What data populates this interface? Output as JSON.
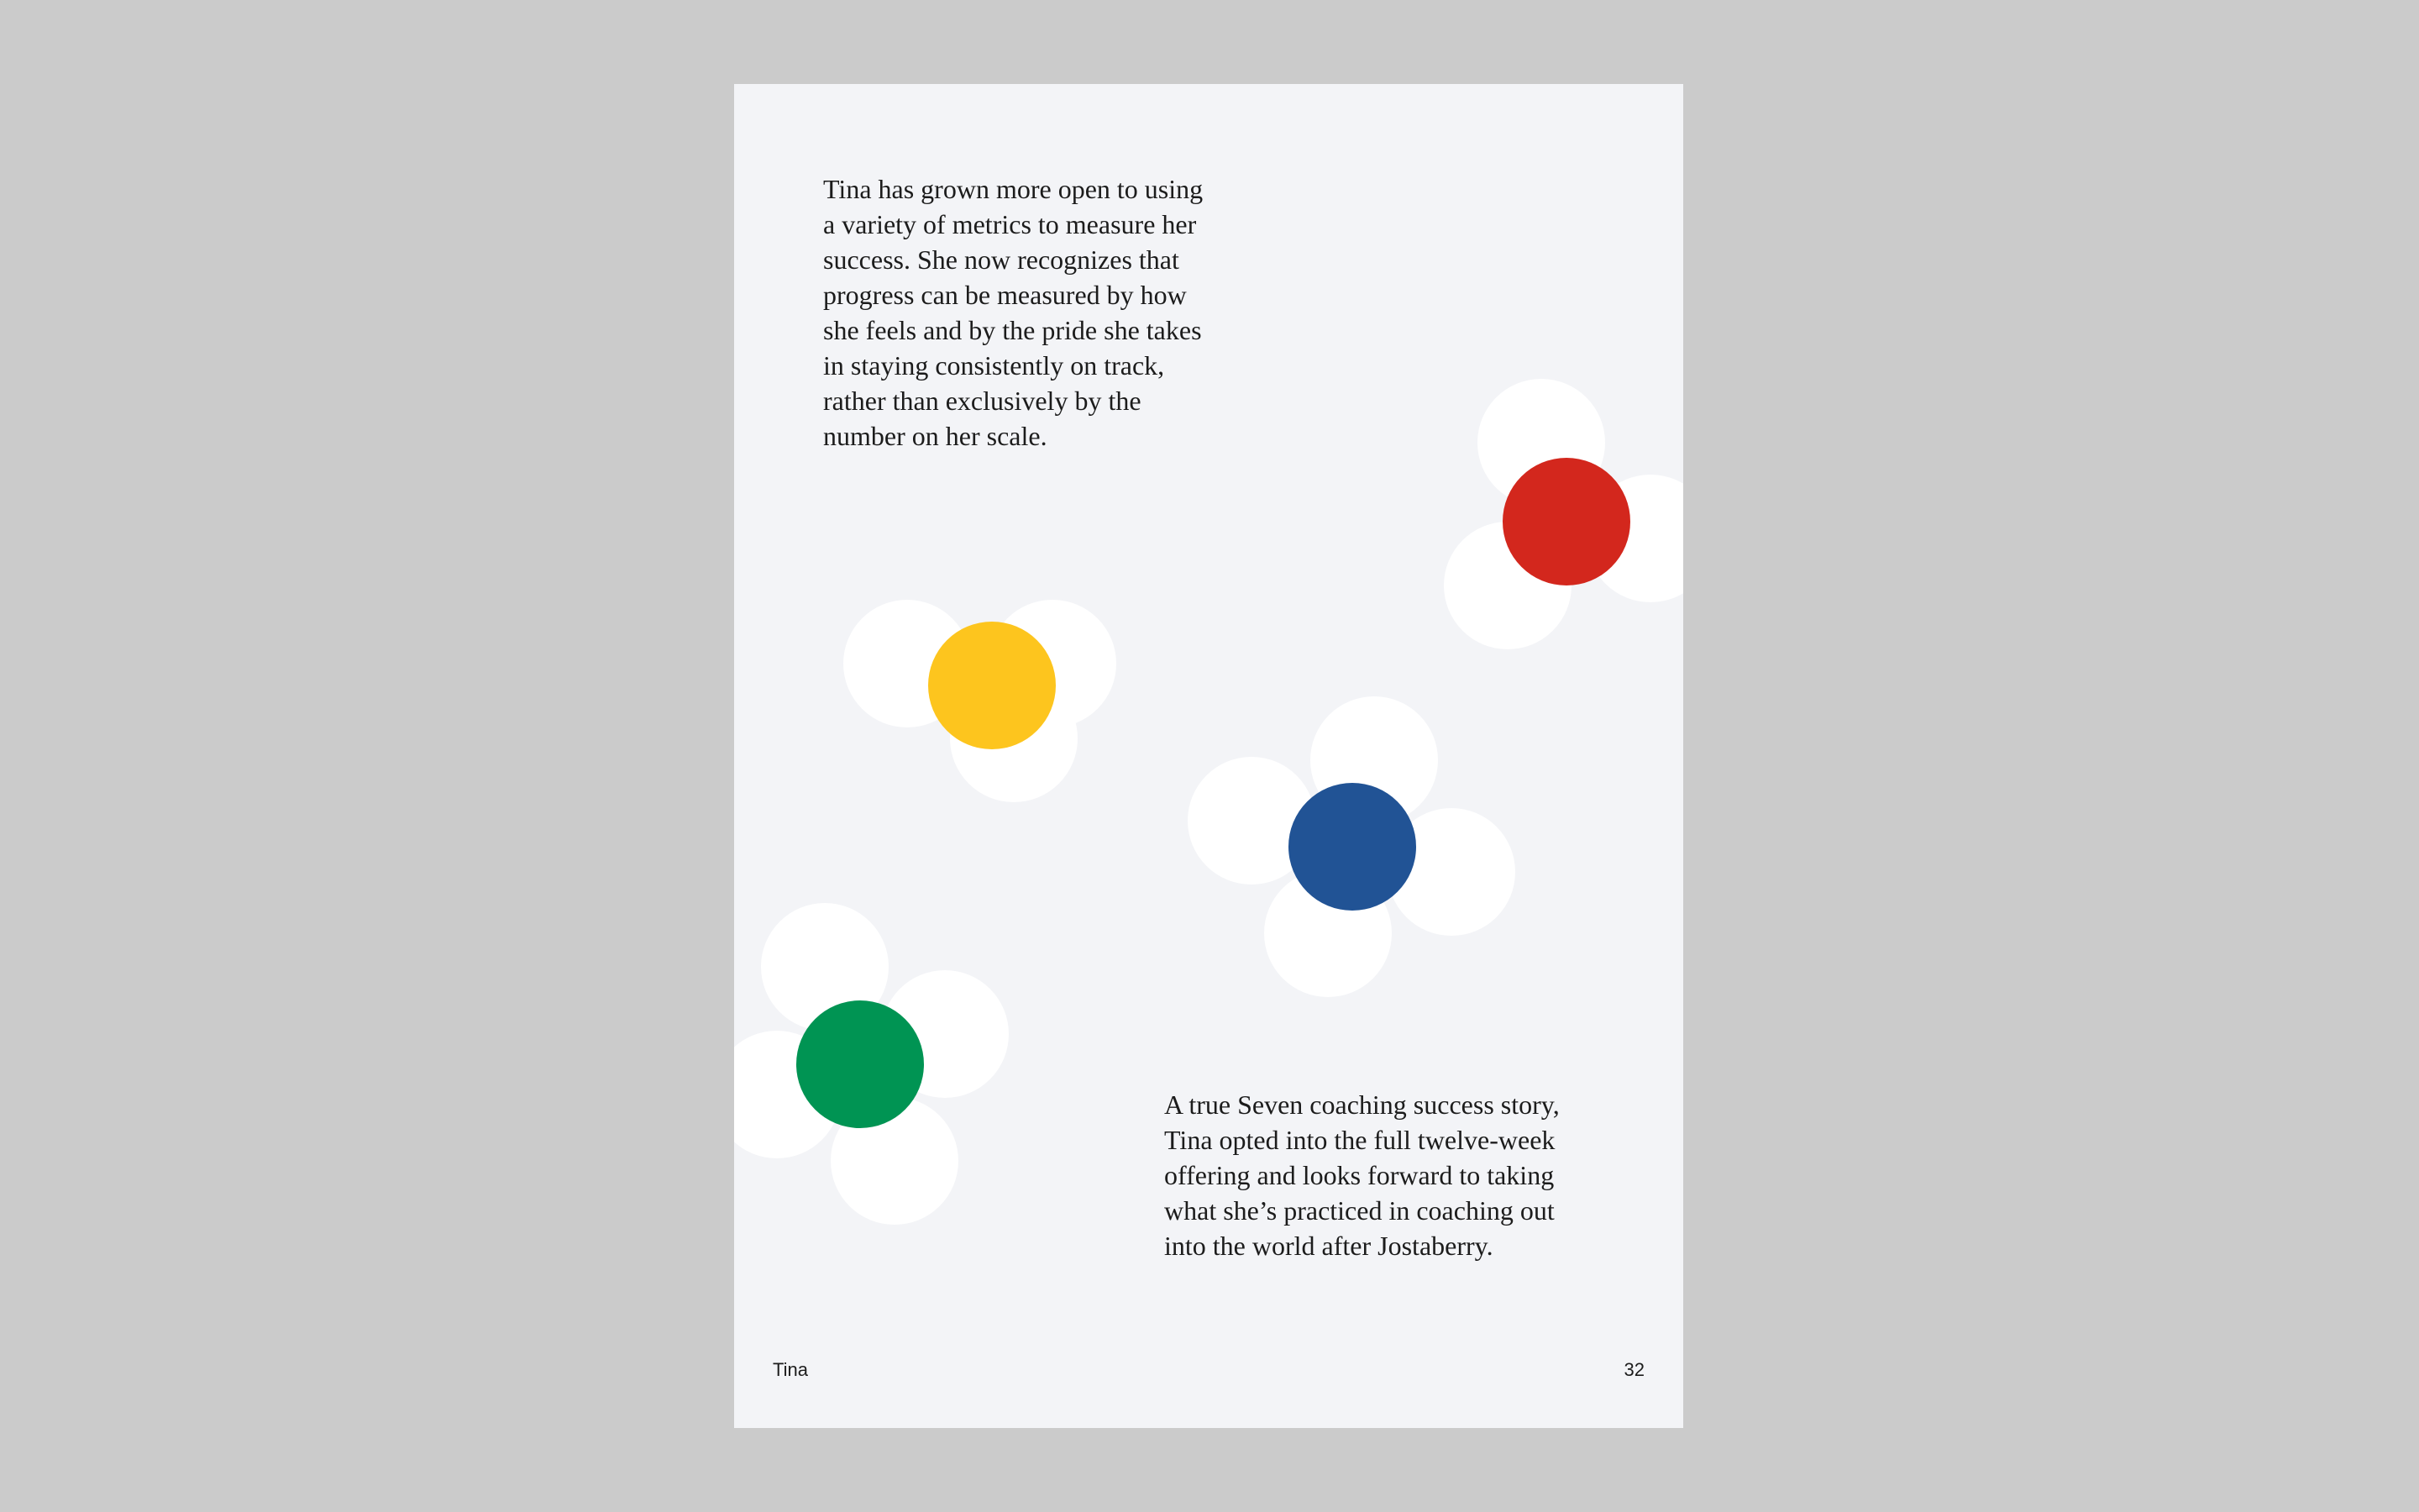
{
  "page": {
    "paragraph_top": "Tina has grown more open to using\na variety of metrics to measure her\nsuccess. She now recognizes that\nprogress can be measured by how\nshe feels and by the pride she takes\nin staying consistently on track,\nrather than exclusively by the\nnumber on her scale.",
    "paragraph_bottom": "A true Seven coaching success story,\nTina opted into the full twelve-week\noffering and looks forward to taking\nwhat she’s practiced in coaching out\ninto the world after Jostaberry.",
    "footer_left": "Tina",
    "footer_right": "32"
  },
  "colors": {
    "background": "#cbcbcb",
    "page": "#f3f4f7",
    "petal": "#ffffff",
    "yellow": "#fdc51e",
    "red": "#d3271d",
    "blue": "#215395",
    "green": "#009453"
  }
}
